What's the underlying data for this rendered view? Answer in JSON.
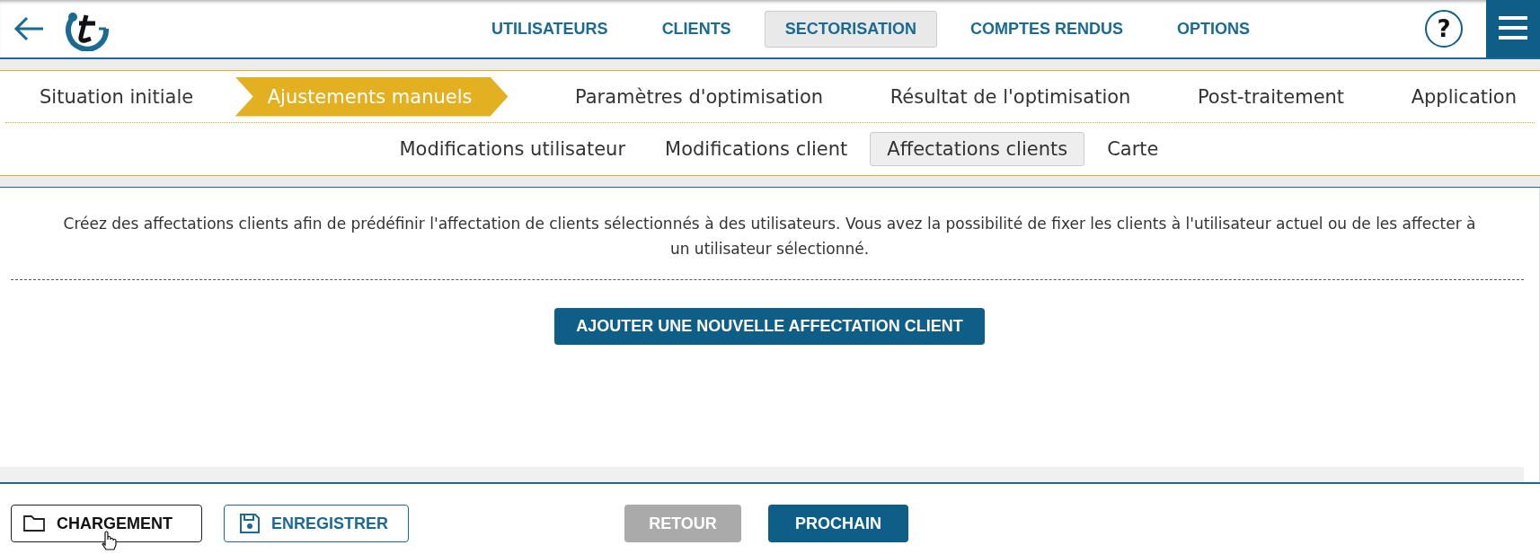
{
  "nav": [
    {
      "label": "UTILISATEURS",
      "selected": false
    },
    {
      "label": "CLIENTS",
      "selected": false
    },
    {
      "label": "SECTORISATION",
      "selected": true
    },
    {
      "label": "COMPTES RENDUS",
      "selected": false
    },
    {
      "label": "OPTIONS",
      "selected": false
    }
  ],
  "help": "?",
  "steps": [
    {
      "label": "Situation initiale",
      "selected": false
    },
    {
      "label": "Ajustements manuels",
      "selected": true
    },
    {
      "label": "Paramètres d'optimisation",
      "selected": false
    },
    {
      "label": "Résultat de l'optimisation",
      "selected": false
    },
    {
      "label": "Post-traitement",
      "selected": false
    },
    {
      "label": "Application",
      "selected": false
    }
  ],
  "subtabs": [
    {
      "label": "Modifications utilisateur",
      "selected": false
    },
    {
      "label": "Modifications client",
      "selected": false
    },
    {
      "label": "Affectations clients",
      "selected": true
    },
    {
      "label": "Carte",
      "selected": false
    }
  ],
  "description": "Créez des affectations clients afin de prédéfinir l'affectation de clients sélectionnés à des utilisateurs. Vous avez la possibilité de fixer les clients à l'utilisateur actuel ou de les affecter à un utilisateur sélectionné.",
  "add_button": "AJOUTER UNE NOUVELLE AFFECTATION CLIENT",
  "footer": [
    {
      "kind": "load",
      "label": "CHARGEMENT",
      "disabled": false
    },
    {
      "kind": "save",
      "label": "ENREGISTRER",
      "disabled": false
    },
    {
      "kind": "back",
      "label": "RETOUR",
      "disabled": true
    },
    {
      "kind": "next",
      "label": "PROCHAIN",
      "disabled": false
    }
  ]
}
